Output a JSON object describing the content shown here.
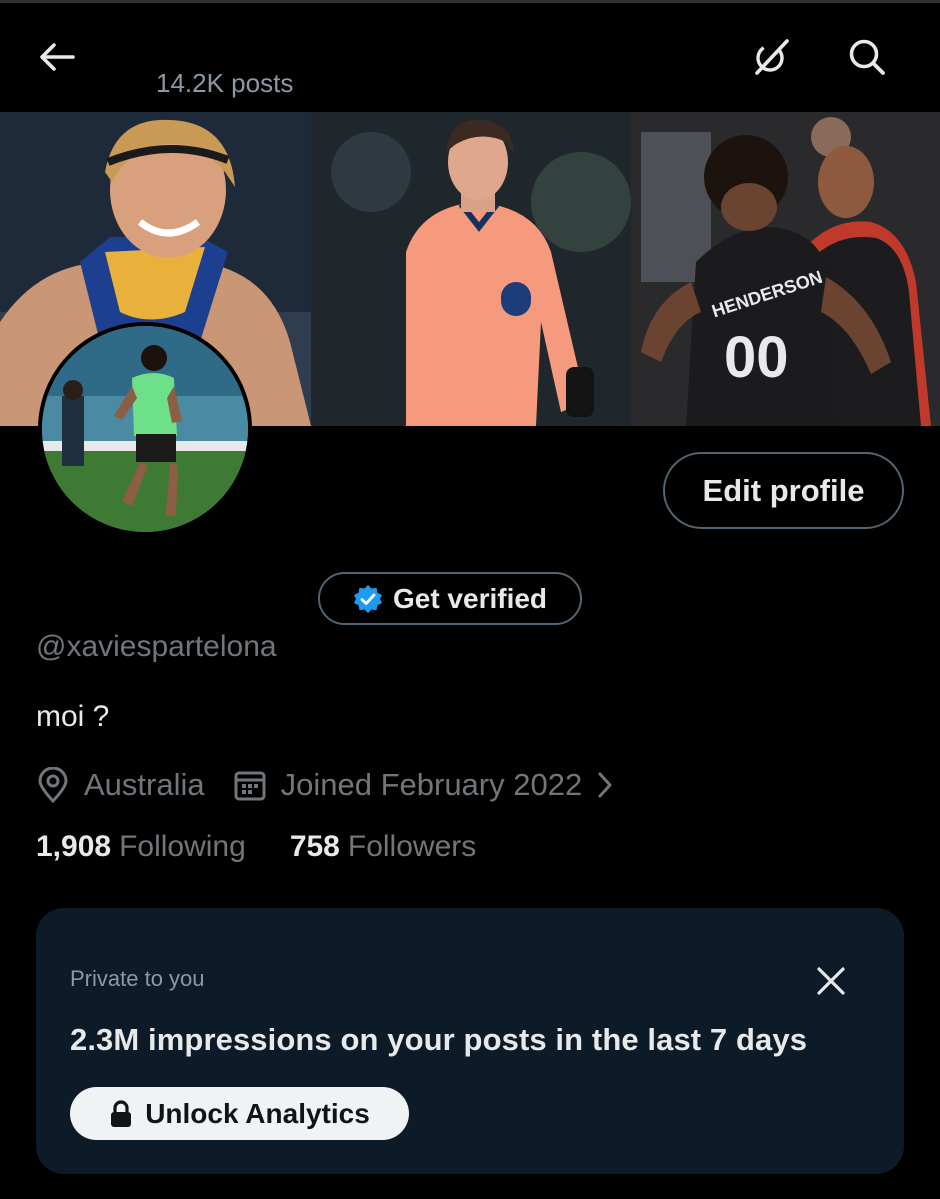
{
  "header": {
    "posts_count": "14.2K posts",
    "icons": {
      "back": "back-arrow-icon",
      "grok": "grok-icon",
      "search": "search-icon"
    }
  },
  "banner": {
    "photos": [
      {
        "subject": "smiling-athlete-photo"
      },
      {
        "subject": "footballer-in-pink-kit-photo"
      },
      {
        "subject": "basketball-players-celebrating-photo"
      }
    ],
    "jersey_name": "HENDERSON",
    "jersey_number": "00"
  },
  "profile": {
    "edit_label": "Edit profile",
    "verify_label": "Get verified",
    "handle": "@xaviespartelona",
    "bio": "moi ?",
    "location": "Australia",
    "joined": "Joined February 2022",
    "following_count": "1,908",
    "following_label": "Following",
    "followers_count": "758",
    "followers_label": "Followers"
  },
  "analytics_card": {
    "kicker": "Private to you",
    "headline": "2.3M impressions on your posts in the last 7 days",
    "button_label": "Unlock Analytics"
  },
  "colors": {
    "background": "#000000",
    "primary_text": "#e7e9ea",
    "secondary_text": "#71767b",
    "border": "#536471",
    "card_bg": "#0d1b29",
    "verified_blue": "#1d9bf0"
  }
}
